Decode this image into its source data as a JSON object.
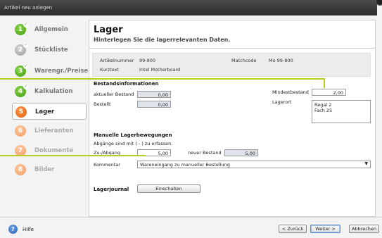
{
  "window": {
    "title": "Artikel neu anlegen"
  },
  "sidebar": {
    "items": [
      {
        "number": "1",
        "label": "Allgemein",
        "state": "done"
      },
      {
        "number": "2",
        "label": "Stückliste",
        "state": "skipped"
      },
      {
        "number": "3",
        "label": "Warengr./Preise",
        "state": "done"
      },
      {
        "number": "4",
        "label": "Kalkulation",
        "state": "done"
      },
      {
        "number": "5",
        "label": "Lager",
        "state": "active"
      },
      {
        "number": "6",
        "label": "Lieferanten",
        "state": "pending"
      },
      {
        "number": "7",
        "label": "Dokumente",
        "state": "pending"
      },
      {
        "number": "8",
        "label": "Bilder",
        "state": "pending"
      }
    ],
    "check_glyph": "✓"
  },
  "header": {
    "title": "Lager",
    "subtitle": "Hinterlegen Sie die lagerrelevanten Daten."
  },
  "article_info": {
    "nr_label": "Artikelnummer",
    "nr_value": "99-800",
    "kurztext_label": "Kurztext",
    "kurztext_value": "Intel Motherboard",
    "matchcode_label": "Matchcode",
    "matchcode_value": "Mo 99-800"
  },
  "bestand": {
    "heading": "Bestandsinformationen",
    "aktuell_label": "aktueller Bestand",
    "aktuell_value": "0,00",
    "bestellt_label": "Bestellt",
    "bestellt_value": "0,00",
    "mindest_label": "Mindestbestand",
    "mindest_value": "2,00",
    "lagerort_label": "Lagerort",
    "lagerort_lines": [
      "Regal 2",
      "Fach 25"
    ]
  },
  "bewegung": {
    "heading": "Manuelle Lagerbewegungen",
    "hint": "Abgänge sind mit ( - ) zu erfassen.",
    "zu_label": "Zu-/Abgang",
    "zu_value": "5,00",
    "neu_label": "neuer Bestand",
    "neu_value": "5,00",
    "kommentar_label": "Kommentar",
    "kommentar_value": "Wareneingang zu manueller Bestellung"
  },
  "journal": {
    "label": "Lagerjournal",
    "button": "Einschalten"
  },
  "footer": {
    "help_glyph": "?",
    "help_label": "Hilfe",
    "back": "< Zurück",
    "next": "Weiter >",
    "cancel": "Abbrechen"
  },
  "colors": {
    "callout": "#b8cc24",
    "done": "#3f9a12",
    "active": "#e05a10"
  }
}
